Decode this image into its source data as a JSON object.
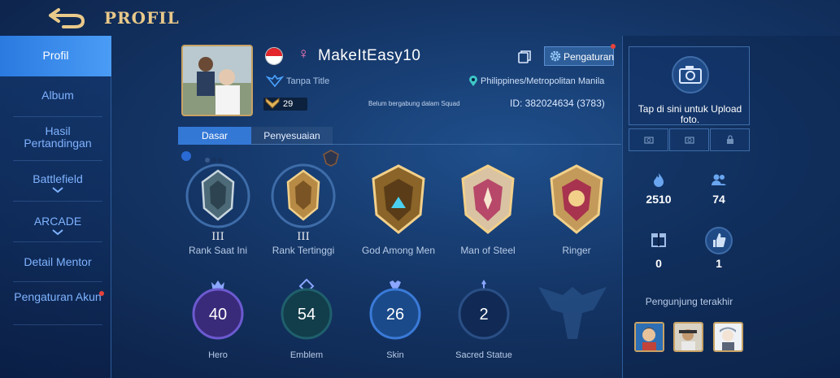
{
  "header": {
    "title": "PROFIL"
  },
  "sidebar": {
    "items": [
      {
        "label": "Profil"
      },
      {
        "label": "Album"
      },
      {
        "label": "Hasil Pertandingan"
      },
      {
        "label": "Battlefield"
      },
      {
        "label": "ARCADE"
      },
      {
        "label": "Detail Mentor"
      },
      {
        "label": "Pengaturan Akun"
      }
    ]
  },
  "profile": {
    "username": "MakeItEasy10",
    "gender_symbol": "♀",
    "title": "Tanpa Title",
    "location": "Philippines/Metropolitan Manila",
    "level": "29",
    "squad": "Belum bergabung dalam Squad",
    "id_text": "ID: 382024634 (3783)",
    "settings_label": "Pengaturan"
  },
  "tabs": [
    {
      "label": "Dasar"
    },
    {
      "label": "Penyesuaian"
    }
  ],
  "medals": [
    {
      "label": "Rank Saat Ini",
      "tier": "III"
    },
    {
      "label": "Rank Tertinggi",
      "tier": "III"
    },
    {
      "label": "God Among Men"
    },
    {
      "label": "Man of Steel"
    },
    {
      "label": "Ringer"
    }
  ],
  "stats": [
    {
      "label": "Hero",
      "value": "40"
    },
    {
      "label": "Emblem",
      "value": "54"
    },
    {
      "label": "Skin",
      "value": "26"
    },
    {
      "label": "Sacred Statue",
      "value": "2"
    }
  ],
  "right_panel": {
    "upload_text": "Tap di sini untuk Upload foto.",
    "popularity": "2510",
    "followers": "74",
    "gifts": "0",
    "likes": "1",
    "visitors_label": "Pengunjung terakhir"
  },
  "colors": {
    "accent": "#3478d6",
    "gold": "#e9c98a",
    "alert": "#e8423a"
  }
}
